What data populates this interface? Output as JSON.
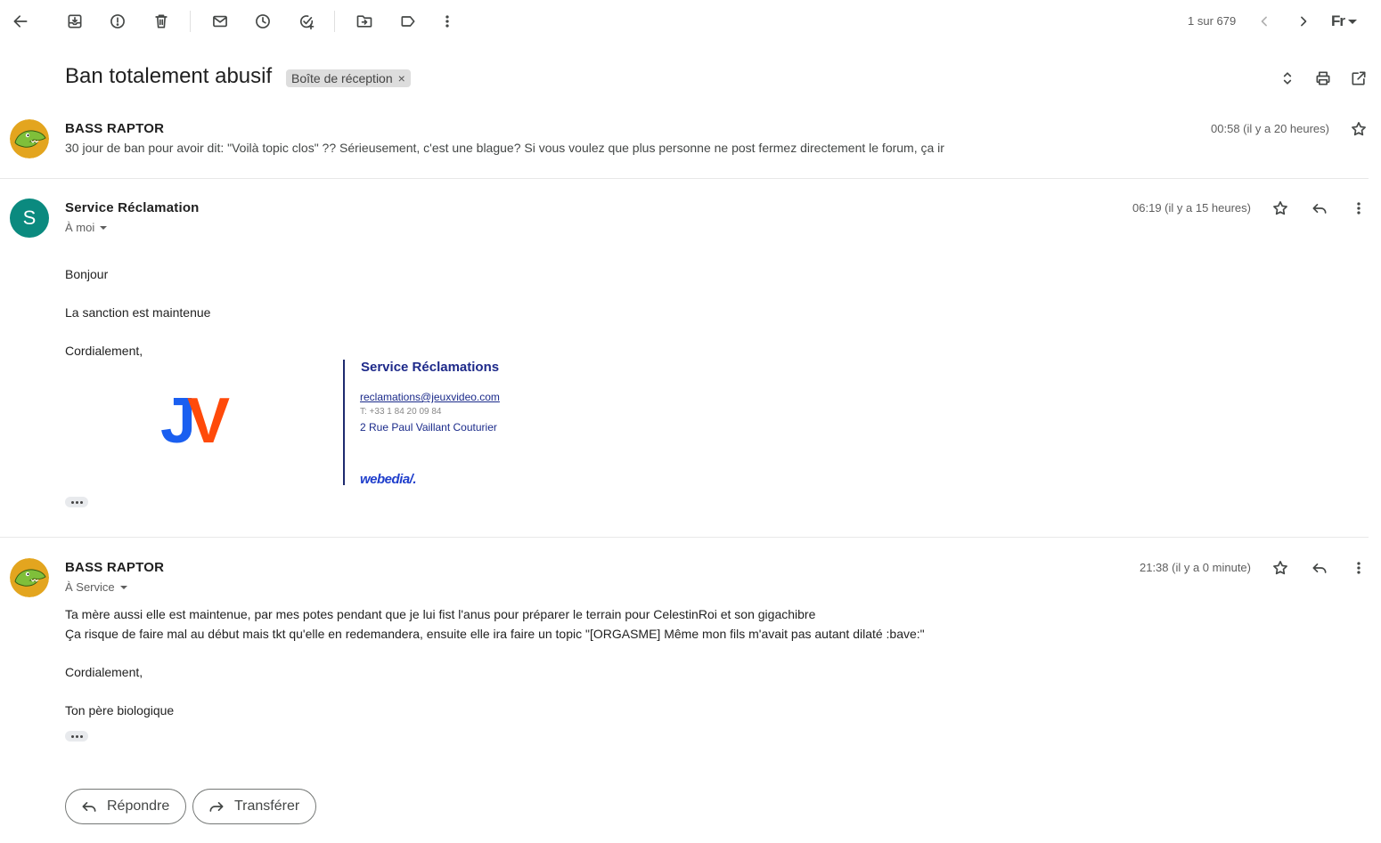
{
  "toolbar": {
    "icons": [
      "back-arrow-icon",
      "archive-icon",
      "report-spam-icon",
      "delete-icon",
      "mark-unread-icon",
      "snooze-icon",
      "add-task-icon",
      "move-to-icon",
      "label-icon",
      "more-vert-icon"
    ],
    "pager_text": "1 sur 679",
    "input_tools_label": "Fr"
  },
  "thread": {
    "subject": "Ban totalement abusif",
    "label": "Boîte de réception"
  },
  "messages": [
    {
      "sender": "BASS RAPTOR",
      "time": "00:58 (il y a 20 heures)",
      "snippet": "30 jour de ban pour avoir dit: \"Voilà topic clos\" ?? Sérieusement, c'est une blague? Si vous voulez que plus personne ne post fermez directement le forum, ça ir"
    },
    {
      "sender": "Service Réclamation",
      "avatar_letter": "S",
      "avatar_color": "#0b8a7f",
      "recipient": "À moi",
      "time": "06:19 (il y a 15 heures)",
      "body": [
        "Bonjour",
        "La sanction est maintenue",
        "Cordialement,"
      ],
      "signature": {
        "logo_j": "J",
        "logo_v": "V",
        "title": "Service Réclamations",
        "email": "reclamations@jeuxvideo.com",
        "phone": "T: +33 1 84 20 09 84",
        "address": "2 Rue Paul Vaillant Couturier",
        "brand": "webedia/."
      }
    },
    {
      "sender": "BASS RAPTOR",
      "recipient": "À Service",
      "time": "21:38 (il y a 0 minute)",
      "body": [
        "Ta mère aussi elle est maintenue, par mes potes pendant que je lui fist l'anus pour préparer le terrain pour CelestinRoi et son gigachibre",
        "Ça risque de faire mal au début mais tkt qu'elle en redemandera, ensuite elle ira faire un topic \"[ORGASME] Même mon fils m'avait pas autant dilaté :bave:\"",
        "Cordialement,",
        "Ton père biologique"
      ]
    }
  ],
  "actions": {
    "reply_label": "Répondre",
    "forward_label": "Transférer"
  },
  "colors": {
    "jv_blue": "#1a5ff0",
    "jv_orange": "#ff4a0a",
    "signature_navy": "#1e2a8a",
    "webedia_blue": "#1f3ecc"
  }
}
